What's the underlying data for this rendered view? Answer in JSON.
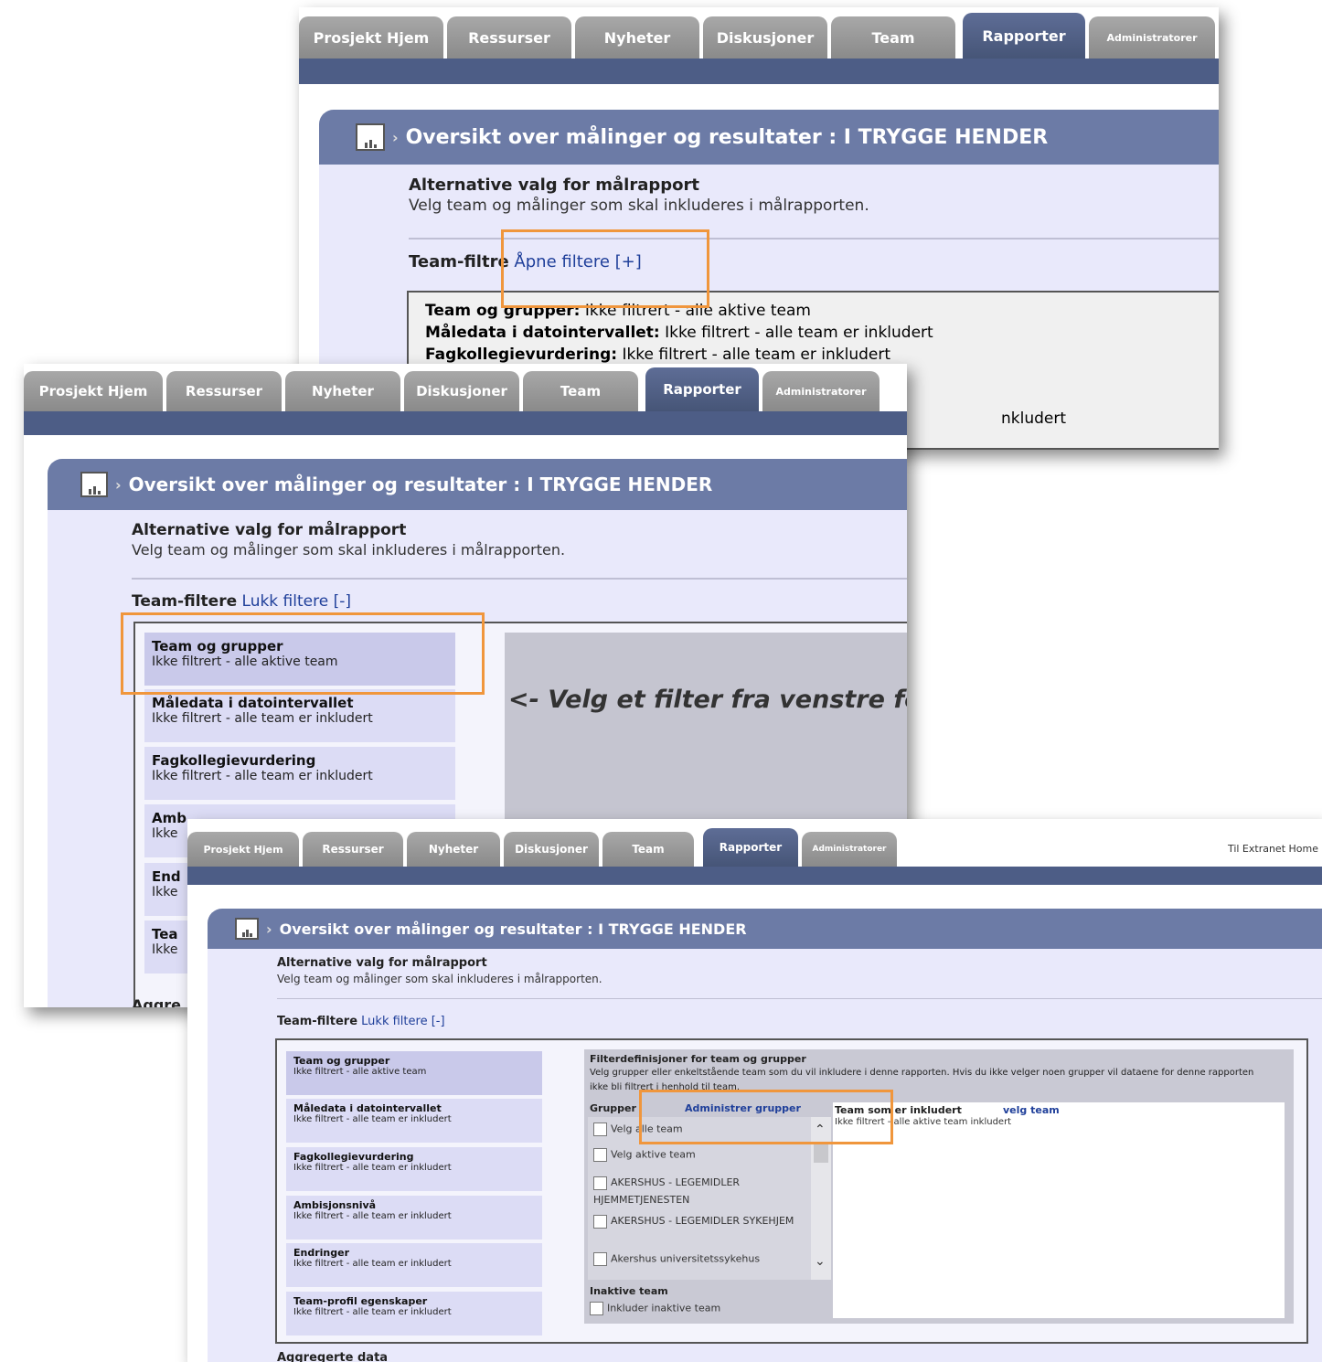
{
  "tabs": [
    "Prosjekt Hjem",
    "Ressurser",
    "Nyheter",
    "Diskusjoner",
    "Team",
    "Rapporter",
    "Administratorer"
  ],
  "active_tab": "Rapporter",
  "extranet_link": "Til Extranet Home",
  "page_title": "Oversikt over målinger og resultater : I TRYGGE HENDER",
  "section_title": "Alternative valg for målrapport",
  "section_subtitle": "Velg team og målinger som skal inkluderes i målrapporten.",
  "shot1": {
    "filter_label": "Team-filt",
    "filter_label_tail": "re",
    "open_link": "Åpne filtere [+]",
    "summary": [
      {
        "label": "Team og grupper:",
        "value": "Ikke filtrert - alle aktive team"
      },
      {
        "label": "Måledata i datointervallet:",
        "value": "Ikke filtrert - alle team er inkludert"
      },
      {
        "label": "Fagkollegievurdering:",
        "value": "Ikke filtrert - alle team er inkludert"
      }
    ],
    "tail_text": "nkludert"
  },
  "shot2": {
    "filter_label": "Team-filtere",
    "close_link": "Lukk filtere [-]",
    "filters": [
      {
        "name": "Team og grupper",
        "status": "Ikke filtrert - alle aktive team"
      },
      {
        "name": "Måledata i datointervallet",
        "status": "Ikke filtrert - alle team er inkludert"
      },
      {
        "name": "Fagkollegievurdering",
        "status": "Ikke filtrert - alle team er inkludert"
      },
      {
        "name": "Amb",
        "status": "Ikke"
      },
      {
        "name": "End",
        "status": "Ikke"
      },
      {
        "name": "Tea",
        "status": "Ikke"
      }
    ],
    "prompt": "<- Velg et filter fra venstre fo",
    "bottom_text": "Aggre"
  },
  "shot3": {
    "filter_label": "Team-filtere",
    "close_link": "Lukk filtere [-]",
    "filters": [
      {
        "name": "Team og grupper",
        "status": "Ikke filtrert - alle aktive team"
      },
      {
        "name": "Måledata i datointervallet",
        "status": "Ikke filtrert - alle team er inkludert"
      },
      {
        "name": "Fagkollegievurdering",
        "status": "Ikke filtrert - alle team er inkludert"
      },
      {
        "name": "Ambisjonsnivå",
        "status": "Ikke filtrert - alle team er inkludert"
      },
      {
        "name": "Endringer",
        "status": "Ikke filtrert - alle team er inkludert"
      },
      {
        "name": "Team-profil egenskaper",
        "status": "Ikke filtrert - alle team er inkludert"
      }
    ],
    "def_title": "Filterdefinisjoner for team og grupper",
    "def_text": "Velg grupper eller enkeltstående team som du vil inkludere i denne rapporten. Hvis du ikke velger noen grupper vil dataene for denne rapporten ikke bli filtrert i henhold til team.",
    "groups_label": "Grupper",
    "admin_link": "Administrer grupper",
    "included_label": "Team som er inkludert",
    "select_team_link": "velg team",
    "included_value": "Ikke filtrert - alle aktive team inkludert",
    "checkboxes": [
      "Velg alle team",
      "Velg aktive team",
      "AKERSHUS - LEGEMIDLER HJEMMETJENESTEN",
      "AKERSHUS - LEGEMIDLER SYKEHJEM",
      "Akershus universitetssykehus"
    ],
    "inactive_label": "Inaktive team",
    "inactive_checkbox": "Inkluder inaktive team",
    "bottom_text": "Aggregerte data"
  },
  "colors": {
    "tab_active": "#5e6d96",
    "tab_inactive": "#9a9a9a",
    "band": "#4d5d86",
    "header": "#6c7ba6",
    "panel_bg": "#e9e9fb",
    "highlight": "#f0963c",
    "link": "#1f3f9a"
  }
}
